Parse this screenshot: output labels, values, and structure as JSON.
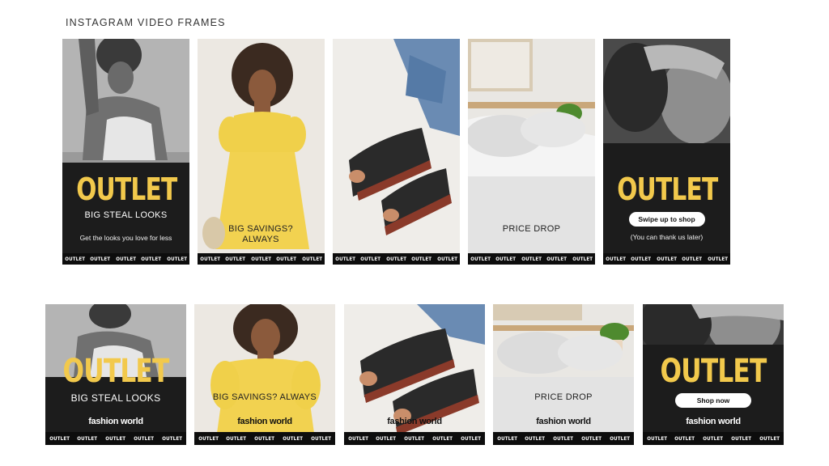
{
  "page_title": "INSTAGRAM VIDEO FRAMES",
  "brand": "fashion world",
  "ticker_word": "OUTLET",
  "colors": {
    "accent_yellow": "#f2c94c",
    "dark_band": "#1c1c1c",
    "ticker_bg": "#0d0d0d"
  },
  "story_frames": [
    {
      "outlet": "OUTLET",
      "headline": "BIG STEAL LOOKS",
      "subline": "Get the looks you love for less"
    },
    {
      "headline": "BIG SAVINGS? ALWAYS"
    },
    {},
    {
      "headline": "PRICE DROP"
    },
    {
      "outlet": "OUTLET",
      "button": "Swipe up to shop",
      "subline": "(You can thank us later)"
    }
  ],
  "post_frames": [
    {
      "outlet": "OUTLET",
      "headline": "BIG STEAL LOOKS"
    },
    {
      "headline": "BIG SAVINGS? ALWAYS"
    },
    {},
    {
      "headline": "PRICE DROP"
    },
    {
      "outlet": "OUTLET",
      "button": "Shop now"
    }
  ]
}
